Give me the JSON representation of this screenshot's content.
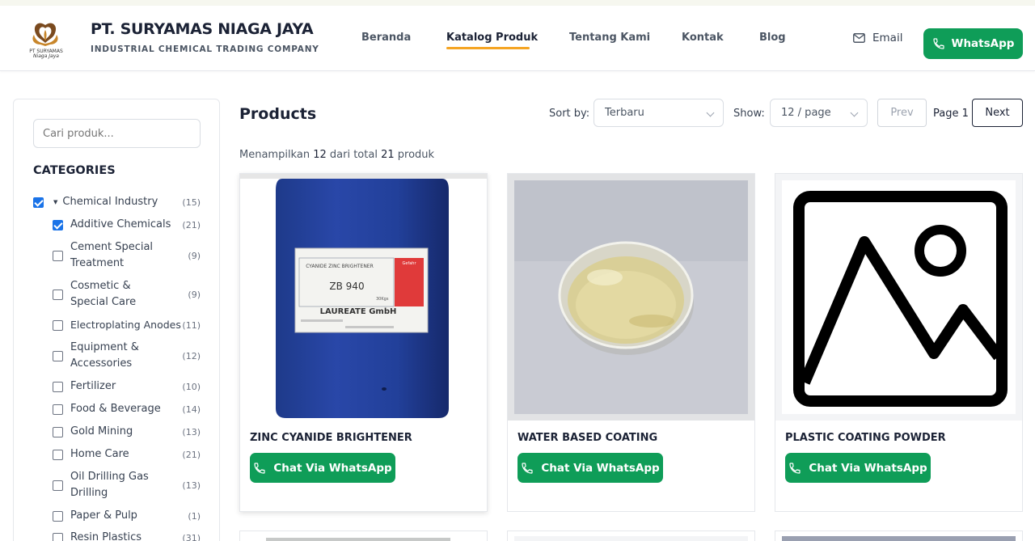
{
  "brand": {
    "name": "PT. SURYAMAS NIAGA JAYA",
    "tagline": "INDUSTRIAL CHEMICAL TRADING COMPANY",
    "logo_text": "PT SURYAMAS",
    "logo_subtext": "Niaga Jaya"
  },
  "nav": {
    "items": [
      "Beranda",
      "Katalog Produk",
      "Tentang Kami",
      "Kontak",
      "Blog"
    ],
    "active": "Katalog Produk",
    "email_label": "Email",
    "whatsapp_label": "WhatsApp"
  },
  "sidebar": {
    "search_placeholder": "Cari produk...",
    "categories_title": "CATEGORIES",
    "categories": [
      {
        "label": "Chemical Industry",
        "count": "(15)",
        "checked": true
      },
      {
        "label": "Additive Chemicals",
        "count": "(21)",
        "checked": true
      },
      {
        "label": "Cement Special Treatment",
        "count": "(9)",
        "checked": false
      },
      {
        "label": "Cosmetic & Special Care",
        "count": "(9)",
        "checked": false
      },
      {
        "label": "Electroplating Anodes",
        "count": "(11)",
        "checked": false
      },
      {
        "label": "Equipment & Accessories",
        "count": "(12)",
        "checked": false
      },
      {
        "label": "Fertilizer",
        "count": "(10)",
        "checked": false
      },
      {
        "label": "Food & Beverage",
        "count": "(14)",
        "checked": false
      },
      {
        "label": "Gold Mining",
        "count": "(13)",
        "checked": false
      },
      {
        "label": "Home Care",
        "count": "(21)",
        "checked": false
      },
      {
        "label": "Oil Drilling Gas Drilling",
        "count": "(13)",
        "checked": false
      },
      {
        "label": "Paper & Pulp",
        "count": "(1)",
        "checked": false
      },
      {
        "label": "Resin Plastics",
        "count": "(31)",
        "checked": false
      }
    ]
  },
  "toolbar": {
    "title": "Products",
    "sort_label": "Sort by:",
    "sort_value": "Terbaru",
    "show_label": "Show:",
    "show_value": "12 / page",
    "prev_label": "Prev",
    "page_label": "Page 1",
    "next_label": "Next",
    "summary_prefix": "Menampilkan",
    "summary_shown": "12",
    "summary_middle": "dari total",
    "summary_total": "21",
    "summary_suffix": "produk"
  },
  "products": [
    {
      "name": "ZINC CYANIDE BRIGHTENER",
      "cta": "Chat Via WhatsApp",
      "image": "blue-drum-photo",
      "drum_label": {
        "header": "CYANIDE ZINC BRIGHTENER",
        "code": "ZB 940",
        "weight": "30Kgs",
        "maker": "LAUREATE GmbH",
        "tag": "Gefahr"
      }
    },
    {
      "name": "WATER BASED COATING",
      "cta": "Chat Via WhatsApp",
      "image": "petri-dish-photo"
    },
    {
      "name": "PLASTIC COATING POWDER",
      "cta": "Chat Via WhatsApp",
      "image": "placeholder-image-icon"
    }
  ],
  "colors": {
    "brand_green": "#0f9d58",
    "nav_underline": "#f5a524",
    "checkbox_blue": "#1a73e8",
    "text_dark": "#1b2235"
  }
}
